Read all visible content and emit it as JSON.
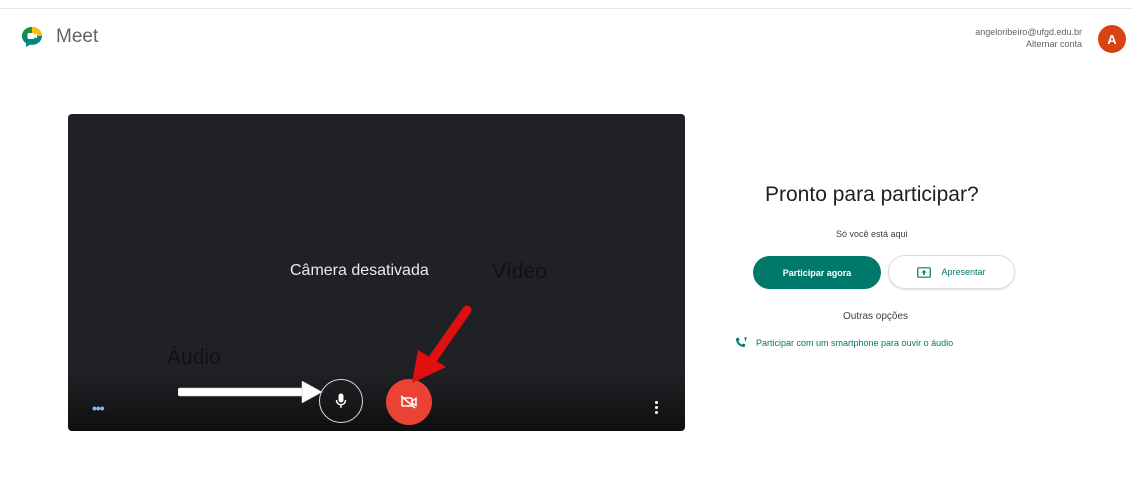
{
  "header": {
    "app_name": "Meet",
    "account_email": "angeloribeiro@ufgd.edu.br",
    "switch_account": "Alternar conta",
    "avatar_letter": "A"
  },
  "preview": {
    "camera_status": "Câmera desativada",
    "mic_icon": "mic-icon",
    "camera_icon": "videocam-off-icon"
  },
  "annotations": {
    "video_label": "Vídeo",
    "audio_label": "Áudio"
  },
  "join_panel": {
    "title": "Pronto para participar?",
    "subtitle": "Só você está aqui",
    "join_button": "Participar agora",
    "present_button": "Apresentar",
    "other_options": "Outras opções",
    "phone_option": "Participar com um smartphone para ouvir o áudio"
  },
  "colors": {
    "accent": "#00796b",
    "camera_off_red": "#ea4335",
    "preview_bg": "#202124",
    "avatar": "#d84315",
    "arrow_red": "#e01010"
  }
}
